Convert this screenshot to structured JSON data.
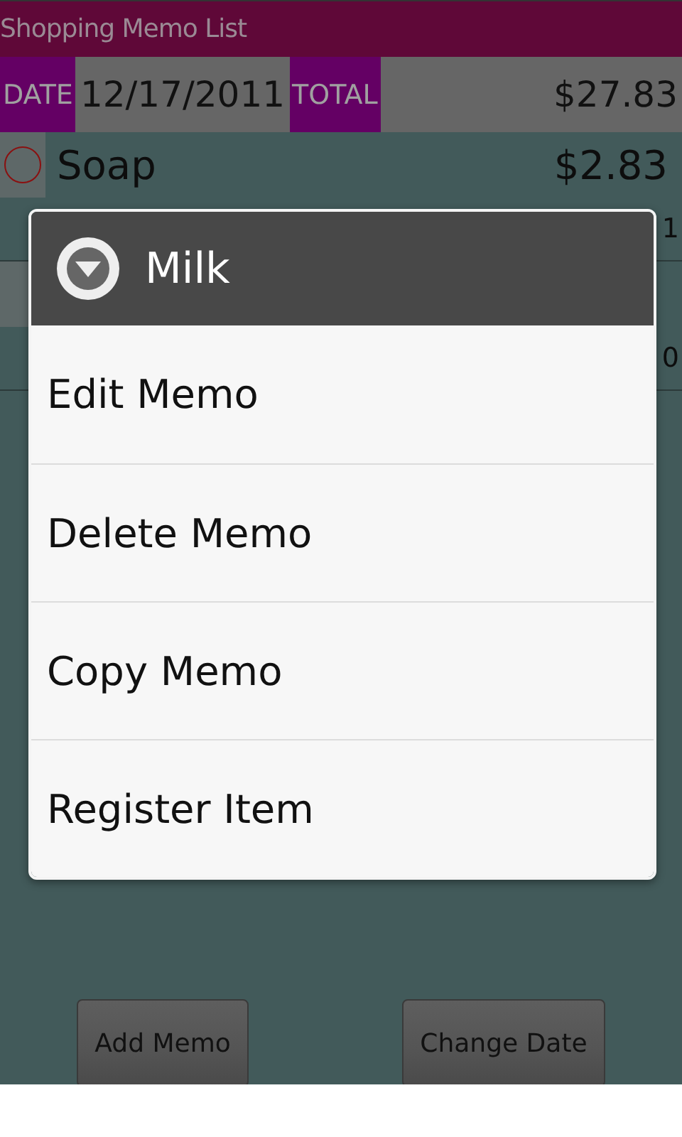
{
  "app_title": "Shopping Memo List",
  "summary": {
    "date_label": "DATE",
    "date": "12/17/2011",
    "total_label": "TOTAL",
    "total": "$27.83"
  },
  "memos": [
    {
      "name": "Soap",
      "price": "$2.83",
      "quantity": "1",
      "checked": false
    },
    {
      "quantity": "0"
    }
  ],
  "context_menu": {
    "title": "Milk",
    "items": [
      "Edit Memo",
      "Delete Memo",
      "Copy Memo",
      "Register Item"
    ]
  },
  "buttons": [
    "Add Memo",
    "Change Date"
  ]
}
